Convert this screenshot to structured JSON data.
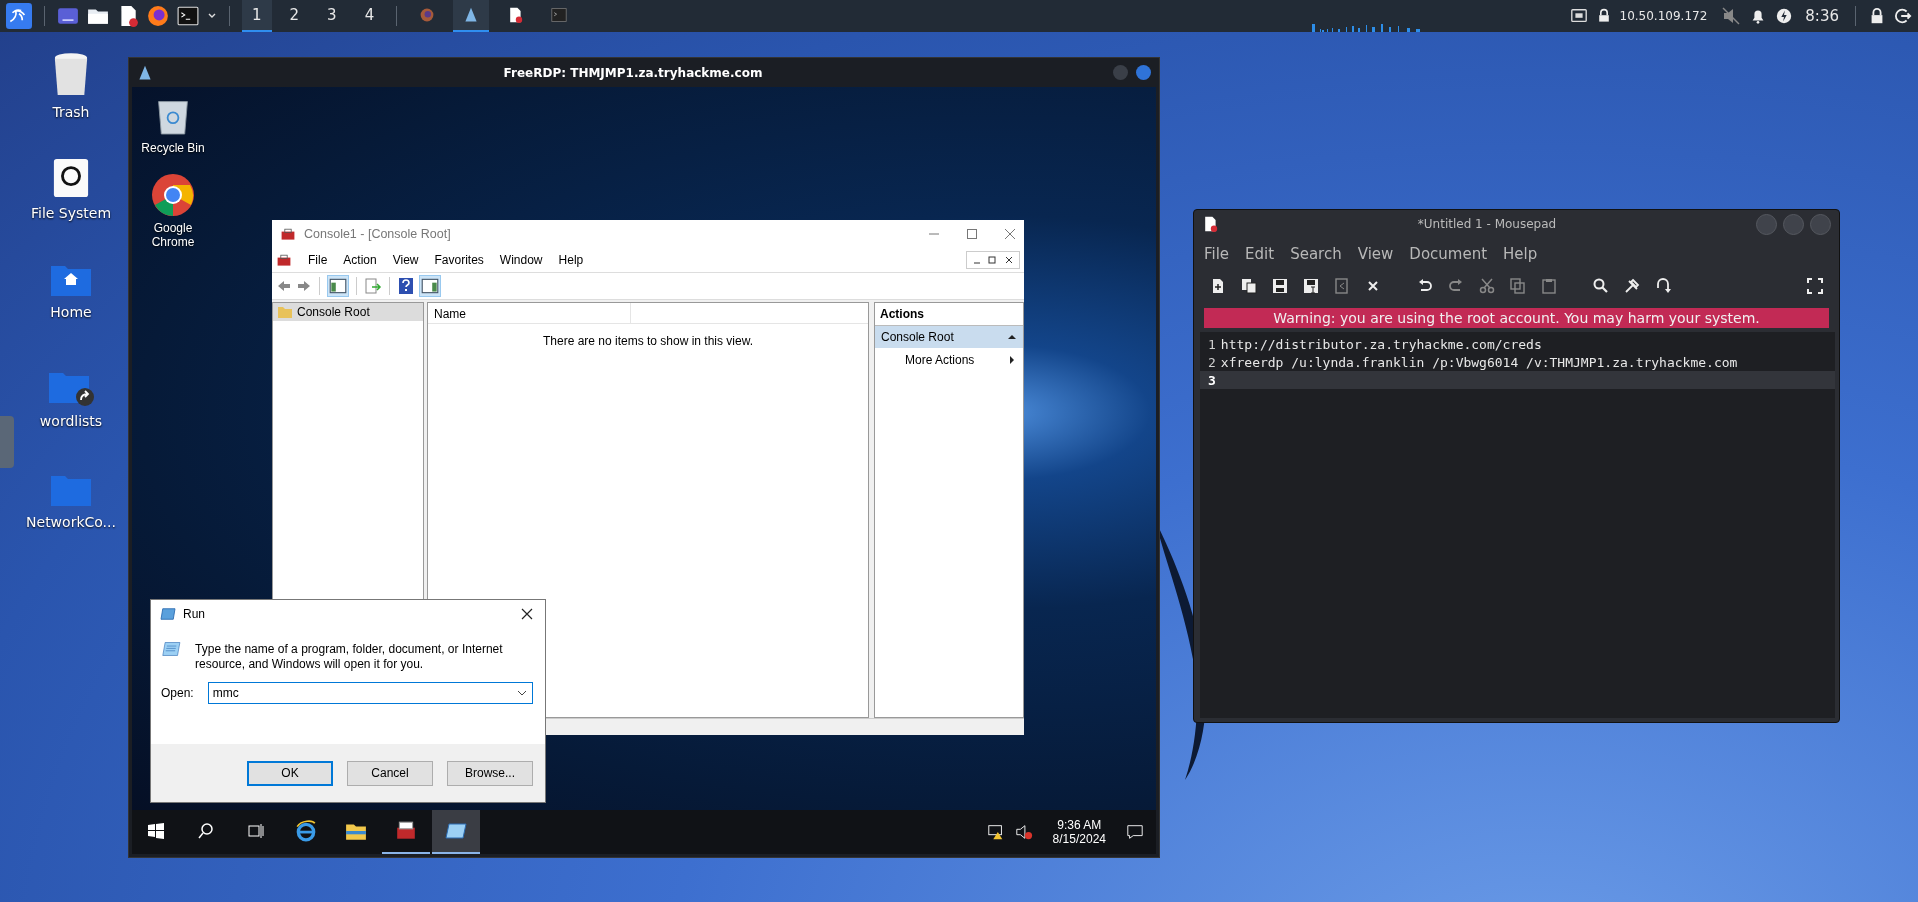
{
  "top_panel": {
    "launchers": [
      {
        "kind": "desktop"
      },
      {
        "kind": "files"
      },
      {
        "kind": "mousepad"
      },
      {
        "kind": "firefox"
      },
      {
        "kind": "terminal"
      }
    ],
    "workspaces": [
      {
        "label": "1",
        "selected": true
      },
      {
        "label": "2",
        "selected": false
      },
      {
        "label": "3",
        "selected": false
      },
      {
        "label": "4",
        "selected": false
      }
    ],
    "window_buttons": [
      {
        "kind": "firefox",
        "selected": false
      },
      {
        "kind": "freerdp",
        "selected": true
      },
      {
        "kind": "mousepad",
        "selected": false
      },
      {
        "kind": "terminal",
        "selected": false
      }
    ],
    "ip_address": "10.50.109.172",
    "clock": "8:36"
  },
  "desktop_icons": [
    {
      "label": "Trash",
      "kind": "trash"
    },
    {
      "label": "File System",
      "kind": "drive"
    },
    {
      "label": "Home",
      "kind": "home"
    },
    {
      "label": "wordlists",
      "kind": "link"
    },
    {
      "label": "NetworkCo...",
      "kind": "folder"
    }
  ],
  "freerdp_window": {
    "title": "FreeRDP: THMJMP1.za.tryhackme.com",
    "desktop_icons": [
      {
        "label": "Recycle Bin",
        "kind": "recycle"
      },
      {
        "label": "Google Chrome",
        "kind": "chrome"
      }
    ],
    "mmc": {
      "title": "Console1 - [Console Root]",
      "menu": [
        "File",
        "Action",
        "View",
        "Favorites",
        "Window",
        "Help"
      ],
      "tree": [
        {
          "label": "Console Root",
          "selected": true
        }
      ],
      "column": "Name",
      "empty_message": "There are no items to show in this view.",
      "actions_header": "Actions",
      "actions_section": "Console Root",
      "actions": [
        "More Actions"
      ]
    },
    "run_dialog": {
      "title": "Run",
      "description": "Type the name of a program, folder, document, or Internet resource, and Windows will open it for you.",
      "open_label": "Open:",
      "value": "mmc",
      "buttons": [
        {
          "label": "OK",
          "default": true
        },
        {
          "label": "Cancel",
          "default": false
        },
        {
          "label": "Browse...",
          "default": false
        }
      ]
    },
    "taskbar": {
      "apps": [
        {
          "kind": "start",
          "running": false,
          "selected": false
        },
        {
          "kind": "search",
          "running": false,
          "selected": false
        },
        {
          "kind": "taskview",
          "running": false,
          "selected": false
        },
        {
          "kind": "ie",
          "running": false,
          "selected": false
        },
        {
          "kind": "explorer",
          "running": false,
          "selected": false
        },
        {
          "kind": "mmc",
          "running": true,
          "selected": false
        },
        {
          "kind": "run",
          "running": true,
          "selected": true
        }
      ],
      "time": "9:36 AM",
      "date": "8/15/2024"
    }
  },
  "mousepad": {
    "title": "*Untitled 1 - Mousepad",
    "menu": [
      "File",
      "Edit",
      "Search",
      "View",
      "Document",
      "Help"
    ],
    "warning": "Warning: you are using the root account. You may harm your system.",
    "lines": [
      {
        "number": "1",
        "text": "http://distributor.za.tryhackme.com/creds",
        "current": false
      },
      {
        "number": "2",
        "text": "xfreerdp /u:lynda.franklin /p:Vbwg6014 /v:THMJMP1.za.tryhackme.com",
        "current": false
      },
      {
        "number": "3",
        "current": true
      }
    ]
  }
}
